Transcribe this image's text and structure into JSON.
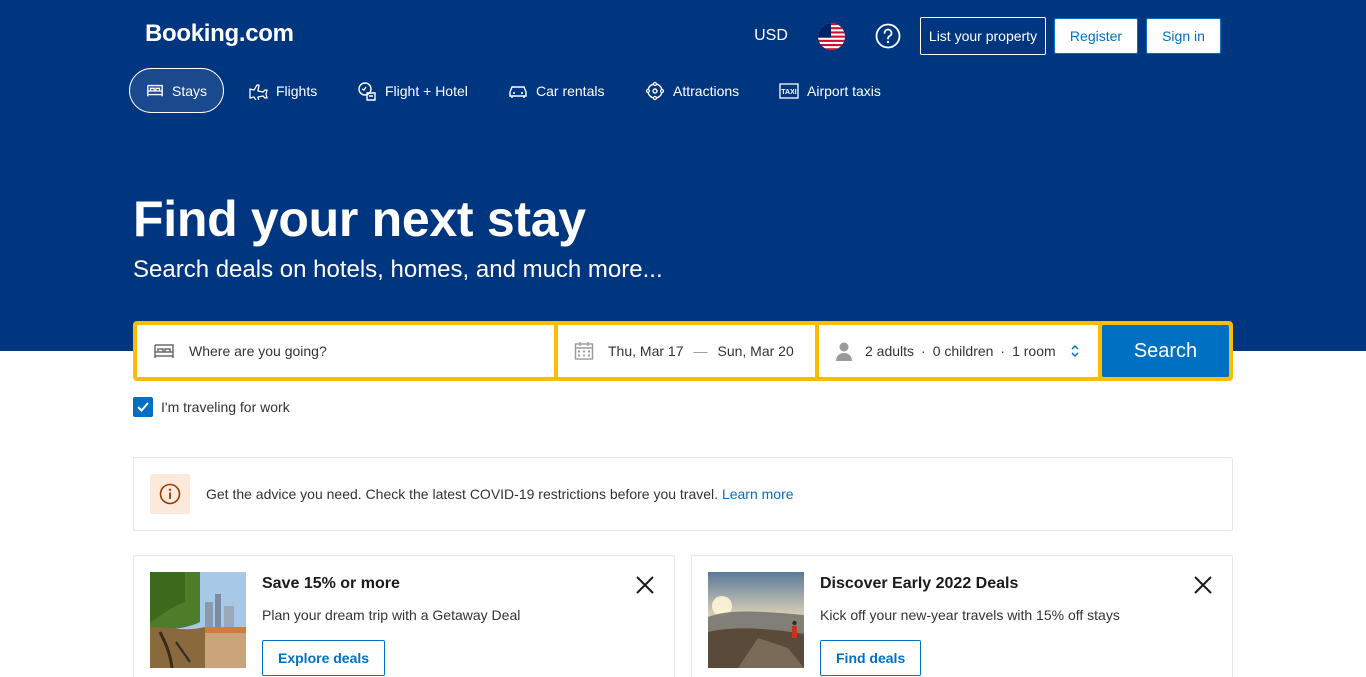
{
  "header": {
    "logo": "Booking.com",
    "currency": "USD",
    "language_flag": "us-flag-icon",
    "help_icon": "question-circle-icon",
    "list_property": "List your property",
    "register": "Register",
    "sign_in": "Sign in"
  },
  "nav": {
    "items": [
      {
        "label": "Stays",
        "icon": "bed-icon",
        "active": true
      },
      {
        "label": "Flights",
        "icon": "plane-icon",
        "active": false
      },
      {
        "label": "Flight + Hotel",
        "icon": "flight-hotel-icon",
        "active": false
      },
      {
        "label": "Car rentals",
        "icon": "car-icon",
        "active": false
      },
      {
        "label": "Attractions",
        "icon": "attractions-icon",
        "active": false
      },
      {
        "label": "Airport taxis",
        "icon": "taxi-icon",
        "active": false
      }
    ]
  },
  "hero": {
    "title": "Find your next stay",
    "subtitle": "Search deals on hotels, homes, and much more..."
  },
  "search": {
    "destination_placeholder": "Where are you going?",
    "checkin": "Thu, Mar 17",
    "date_separator": "—",
    "checkout": "Sun, Mar 20",
    "adults": "2 adults",
    "children": "0 children",
    "rooms": "1 room",
    "separator": "·",
    "button": "Search"
  },
  "work_travel": {
    "label": "I'm traveling for work",
    "checked": true
  },
  "covid": {
    "text": "Get the advice you need. Check the latest COVID-19 restrictions before you travel.",
    "link": "Learn more"
  },
  "cards": [
    {
      "title": "Save 15% or more",
      "description": "Plan your dream trip with a Getaway Deal",
      "button": "Explore deals"
    },
    {
      "title": "Discover Early 2022 Deals",
      "description": "Kick off your new-year travels with 15% off stays",
      "button": "Find deals"
    }
  ],
  "colors": {
    "brand_blue": "#003580",
    "action_blue": "#0071c2",
    "search_border": "#febb02",
    "covid_icon_bg": "#fde9dc"
  }
}
